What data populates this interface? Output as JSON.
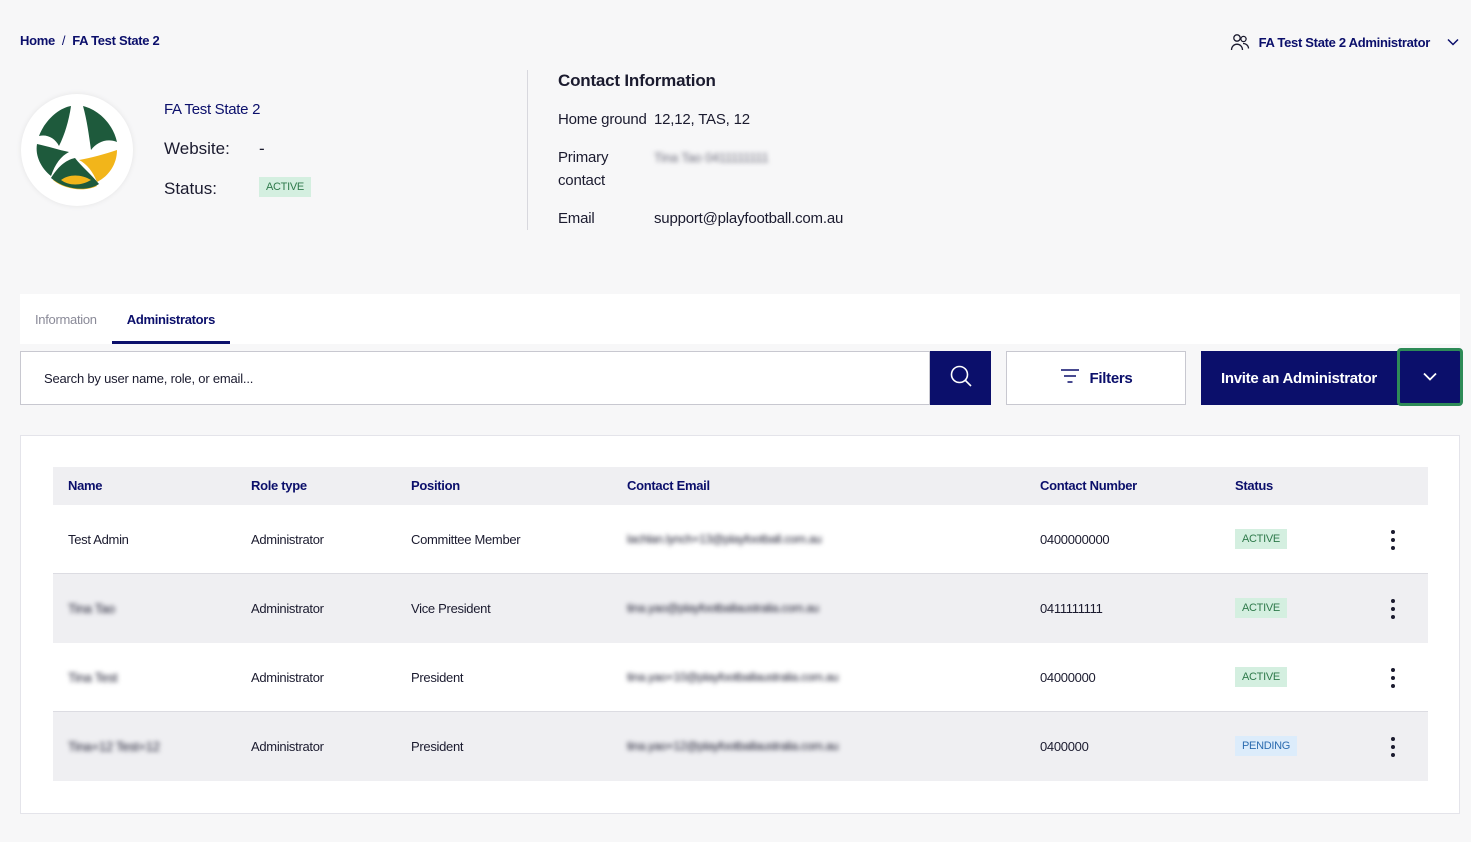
{
  "breadcrumb": {
    "home": "Home",
    "separator": "/",
    "current": "FA Test State 2"
  },
  "user_menu": {
    "label": "FA Test State 2 Administrator",
    "icon": "users-icon",
    "chevron": "chevron-down-icon"
  },
  "org": {
    "name": "FA Test State 2",
    "website_label": "Website:",
    "website_value": "-",
    "status_label": "Status:",
    "status_value": "ACTIVE"
  },
  "contact": {
    "title": "Contact Information",
    "home_ground_label": "Home ground",
    "home_ground_value": "12,12, TAS, 12",
    "primary_label": "Primary contact",
    "primary_value": "Tina Tao 0411111111",
    "email_label": "Email",
    "email_value": "support@playfootball.com.au"
  },
  "tabs": [
    {
      "label": "Information",
      "active": false
    },
    {
      "label": "Administrators",
      "active": true
    }
  ],
  "search": {
    "placeholder": "Search by user name, role, or email...",
    "value": ""
  },
  "toolbar": {
    "filters_label": "Filters",
    "invite_label": "Invite an Administrator"
  },
  "colors": {
    "brand_navy": "#0b0f6b",
    "focus_green": "#2e8b57",
    "active_bg": "#d4efe0",
    "pending_bg": "#dcecfb"
  },
  "table": {
    "headers": [
      "Name",
      "Role type",
      "Position",
      "Contact Email",
      "Contact Number",
      "Status"
    ],
    "rows": [
      {
        "name": "Test Admin",
        "role": "Administrator",
        "position": "Committee Member",
        "email": "lachlan.lynch+13@playfootball.com.au",
        "phone": "0400000000",
        "status": "ACTIVE"
      },
      {
        "name": "Tina Tao",
        "role": "Administrator",
        "position": "Vice President",
        "email": "tina.yao@playfootballaustralia.com.au",
        "phone": "0411111111",
        "status": "ACTIVE"
      },
      {
        "name": "Tina Test",
        "role": "Administrator",
        "position": "President",
        "email": "tina.yao+10@playfootballaustralia.com.au",
        "phone": "04000000",
        "status": "ACTIVE"
      },
      {
        "name": "Tina+12 Test+12",
        "role": "Administrator",
        "position": "President",
        "email": "tina.yao+12@playfootballaustralia.com.au",
        "phone": "0400000",
        "status": "PENDING"
      }
    ]
  }
}
